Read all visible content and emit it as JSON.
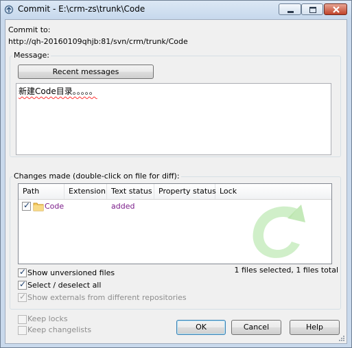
{
  "window": {
    "title": "Commit - E:\\crm-zs\\trunk\\Code",
    "icon": "tortoise-svn-commit-icon"
  },
  "commit_to": {
    "label": "Commit to:",
    "url": "http://qh-20160109qhjb:81/svn/crm/trunk/Code"
  },
  "message": {
    "group_label": "Message:",
    "recent_button": "Recent messages",
    "text": "新建Code目录。。。。。"
  },
  "changes": {
    "group_label": "Changes made (double-click on file for diff):",
    "columns": [
      "Path",
      "Extension",
      "Text status",
      "Property status",
      "Lock"
    ],
    "rows": [
      {
        "checked": true,
        "icon": "folder-icon",
        "path": "Code",
        "extension": "",
        "text_status": "added",
        "property_status": "",
        "lock": ""
      }
    ],
    "summary": "1 files selected, 1 files total",
    "options": {
      "show_unversioned": {
        "label": "Show unversioned files",
        "checked": true
      },
      "select_all": {
        "label": "Select / deselect all",
        "checked": true
      },
      "show_externals": {
        "label": "Show externals from different repositories",
        "checked": true,
        "disabled": true
      }
    }
  },
  "footer": {
    "keep_locks": {
      "label": "Keep locks",
      "checked": false,
      "disabled": true
    },
    "keep_changelists": {
      "label": "Keep changelists",
      "checked": false,
      "disabled": true
    },
    "ok": "OK",
    "cancel": "Cancel",
    "help": "Help"
  },
  "colors": {
    "added_status": "#7b1c8a",
    "title_bar": "#c9d9ec",
    "close_button": "#c0432a"
  }
}
